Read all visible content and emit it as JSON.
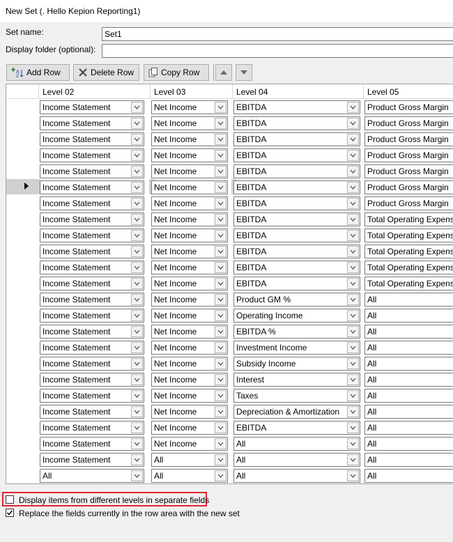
{
  "window": {
    "title": "New Set (. Hello Kepion Reporting1)"
  },
  "form": {
    "set_name_label": "Set name:",
    "set_name_value": "Set1",
    "folder_label": "Display folder (optional):",
    "folder_value": ""
  },
  "toolbar": {
    "add_row": "Add Row",
    "delete_row": "Delete Row",
    "copy_row": "Copy Row"
  },
  "grid": {
    "columns": [
      "Level 02",
      "Level 03",
      "Level 04",
      "Level 05"
    ],
    "current_row": 6,
    "rows": [
      [
        "Income Statement",
        "Net Income",
        "EBITDA",
        "Product Gross Margin"
      ],
      [
        "Income Statement",
        "Net Income",
        "EBITDA",
        "Product Gross Margin"
      ],
      [
        "Income Statement",
        "Net Income",
        "EBITDA",
        "Product Gross Margin"
      ],
      [
        "Income Statement",
        "Net Income",
        "EBITDA",
        "Product Gross Margin"
      ],
      [
        "Income Statement",
        "Net Income",
        "EBITDA",
        "Product Gross Margin"
      ],
      [
        "Income Statement",
        "Net Income",
        "EBITDA",
        "Product Gross Margin"
      ],
      [
        "Income Statement",
        "Net Income",
        "EBITDA",
        "Product Gross Margin"
      ],
      [
        "Income Statement",
        "Net Income",
        "EBITDA",
        "Total Operating Expense"
      ],
      [
        "Income Statement",
        "Net Income",
        "EBITDA",
        "Total Operating Expense"
      ],
      [
        "Income Statement",
        "Net Income",
        "EBITDA",
        "Total Operating Expense"
      ],
      [
        "Income Statement",
        "Net Income",
        "EBITDA",
        "Total Operating Expense"
      ],
      [
        "Income Statement",
        "Net Income",
        "EBITDA",
        "Total Operating Expense"
      ],
      [
        "Income Statement",
        "Net Income",
        "Product GM %",
        "All"
      ],
      [
        "Income Statement",
        "Net Income",
        "Operating Income",
        "All"
      ],
      [
        "Income Statement",
        "Net Income",
        "EBITDA %",
        "All"
      ],
      [
        "Income Statement",
        "Net Income",
        "Investment Income",
        "All"
      ],
      [
        "Income Statement",
        "Net Income",
        "Subsidy Income",
        "All"
      ],
      [
        "Income Statement",
        "Net Income",
        "Interest",
        "All"
      ],
      [
        "Income Statement",
        "Net Income",
        "Taxes",
        "All"
      ],
      [
        "Income Statement",
        "Net Income",
        "Depreciation & Amortization",
        "All"
      ],
      [
        "Income Statement",
        "Net Income",
        "EBITDA",
        "All"
      ],
      [
        "Income Statement",
        "Net Income",
        "All",
        "All"
      ],
      [
        "Income Statement",
        "All",
        "All",
        "All"
      ],
      [
        "All",
        "All",
        "All",
        "All"
      ]
    ]
  },
  "options": {
    "separate_fields": {
      "label": "Display items from different levels in separate fields",
      "checked": false
    },
    "replace_fields": {
      "label": "Replace the fields currently in the row area with the new set",
      "checked": true
    }
  },
  "colors": {
    "highlight": "#e0242f",
    "delete_icon": "#444444"
  }
}
